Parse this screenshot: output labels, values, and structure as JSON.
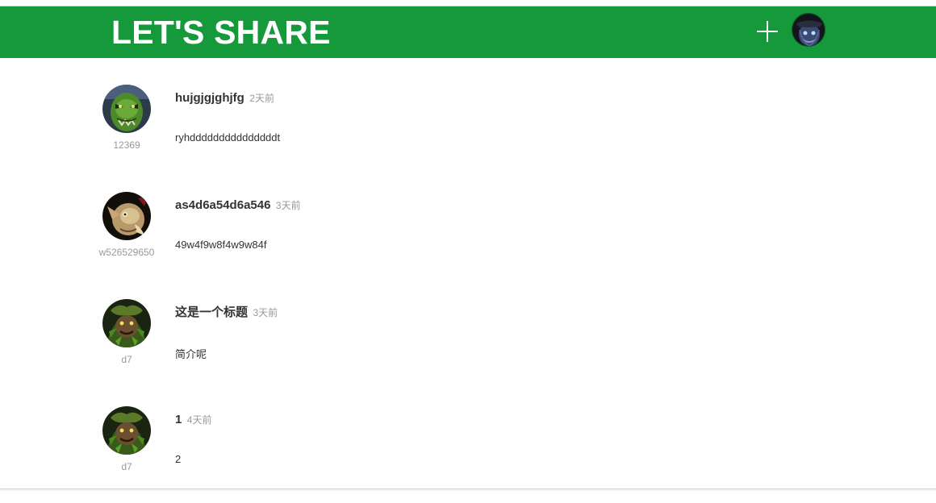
{
  "header": {
    "brand": "LET'S SHARE",
    "background_color": "#15993a",
    "add_icon": "plus-icon",
    "user_avatar": "user-avatar-image"
  },
  "posts": [
    {
      "title": "hujgjgjghjfg",
      "time": "2天前",
      "summary": "ryhdddddddddddddddt",
      "author": "12369",
      "avatar": "orc-avatar"
    },
    {
      "title": "as4d6a54d6a546",
      "time": "3天前",
      "summary": "49w4f9w8f4w9w84f",
      "author": "w526529650",
      "avatar": "goblin-avatar"
    },
    {
      "title": "这是一个标题",
      "time": "3天前",
      "summary": "简介呢",
      "author": "d7",
      "avatar": "treant-avatar"
    },
    {
      "title": "1",
      "time": "4天前",
      "summary": "2",
      "author": "d7",
      "avatar": "treant-avatar"
    }
  ]
}
